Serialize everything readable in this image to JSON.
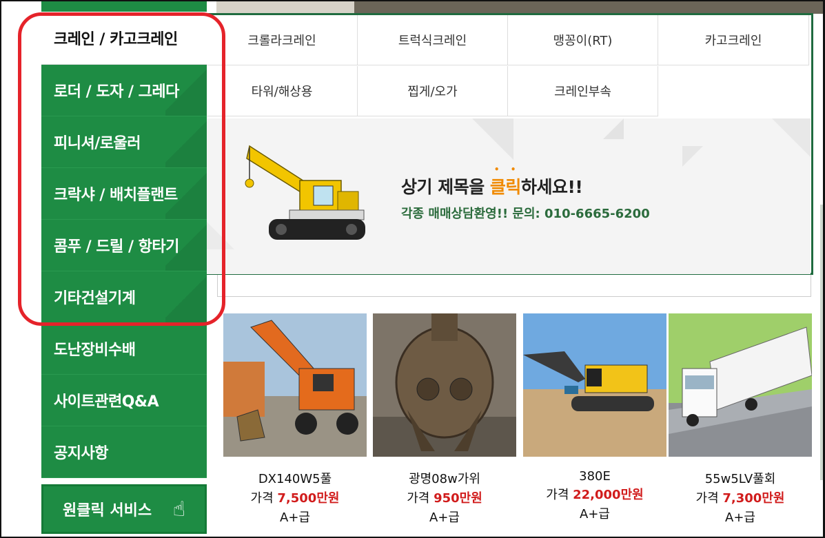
{
  "sidebar": {
    "items": [
      {
        "label": "크레인 / 카고크레인",
        "active": true
      },
      {
        "label": "로더 / 도자 / 그레다"
      },
      {
        "label": "피니셔/로울러"
      },
      {
        "label": "크락샤 / 배치플랜트"
      },
      {
        "label": "콤푸 / 드릴 / 항타기"
      },
      {
        "label": "기타건설기계"
      },
      {
        "label": "도난장비수배"
      },
      {
        "label": "사이트관련Q&A"
      },
      {
        "label": "공지사항"
      }
    ],
    "oneclick_label": "원클릭 서비스"
  },
  "submenu": {
    "row1": [
      "크롤라크레인",
      "트럭식크레인",
      "맹꽁이(RT)",
      "카고크레인"
    ],
    "row2": [
      "타워/해상용",
      "찝게/오가",
      "크레인부속"
    ]
  },
  "promo": {
    "title_before": "상기 제목을 ",
    "title_highlight": "클릭",
    "title_after": "하세요!!",
    "subtitle": "각종 매매상담환영!! 문의: 010-6665-6200"
  },
  "products": [
    {
      "name": "DX140W5풀",
      "price_label": "가격",
      "price": "7,500만원",
      "grade": "A+급"
    },
    {
      "name": "광명08w가위",
      "price_label": "가격",
      "price": "950만원",
      "grade": "A+급"
    },
    {
      "name": "380E",
      "price_label": "가격",
      "price": "22,000만원",
      "grade": "A+급"
    },
    {
      "name": "55w5LV풀회",
      "price_label": "가격",
      "price": "7,300만원",
      "grade": "A+급"
    }
  ],
  "colors": {
    "sidebar_green": "#1e8c44",
    "highlight_red": "#e5232a",
    "price_red": "#d11c1c",
    "promo_orange": "#f08a00"
  }
}
